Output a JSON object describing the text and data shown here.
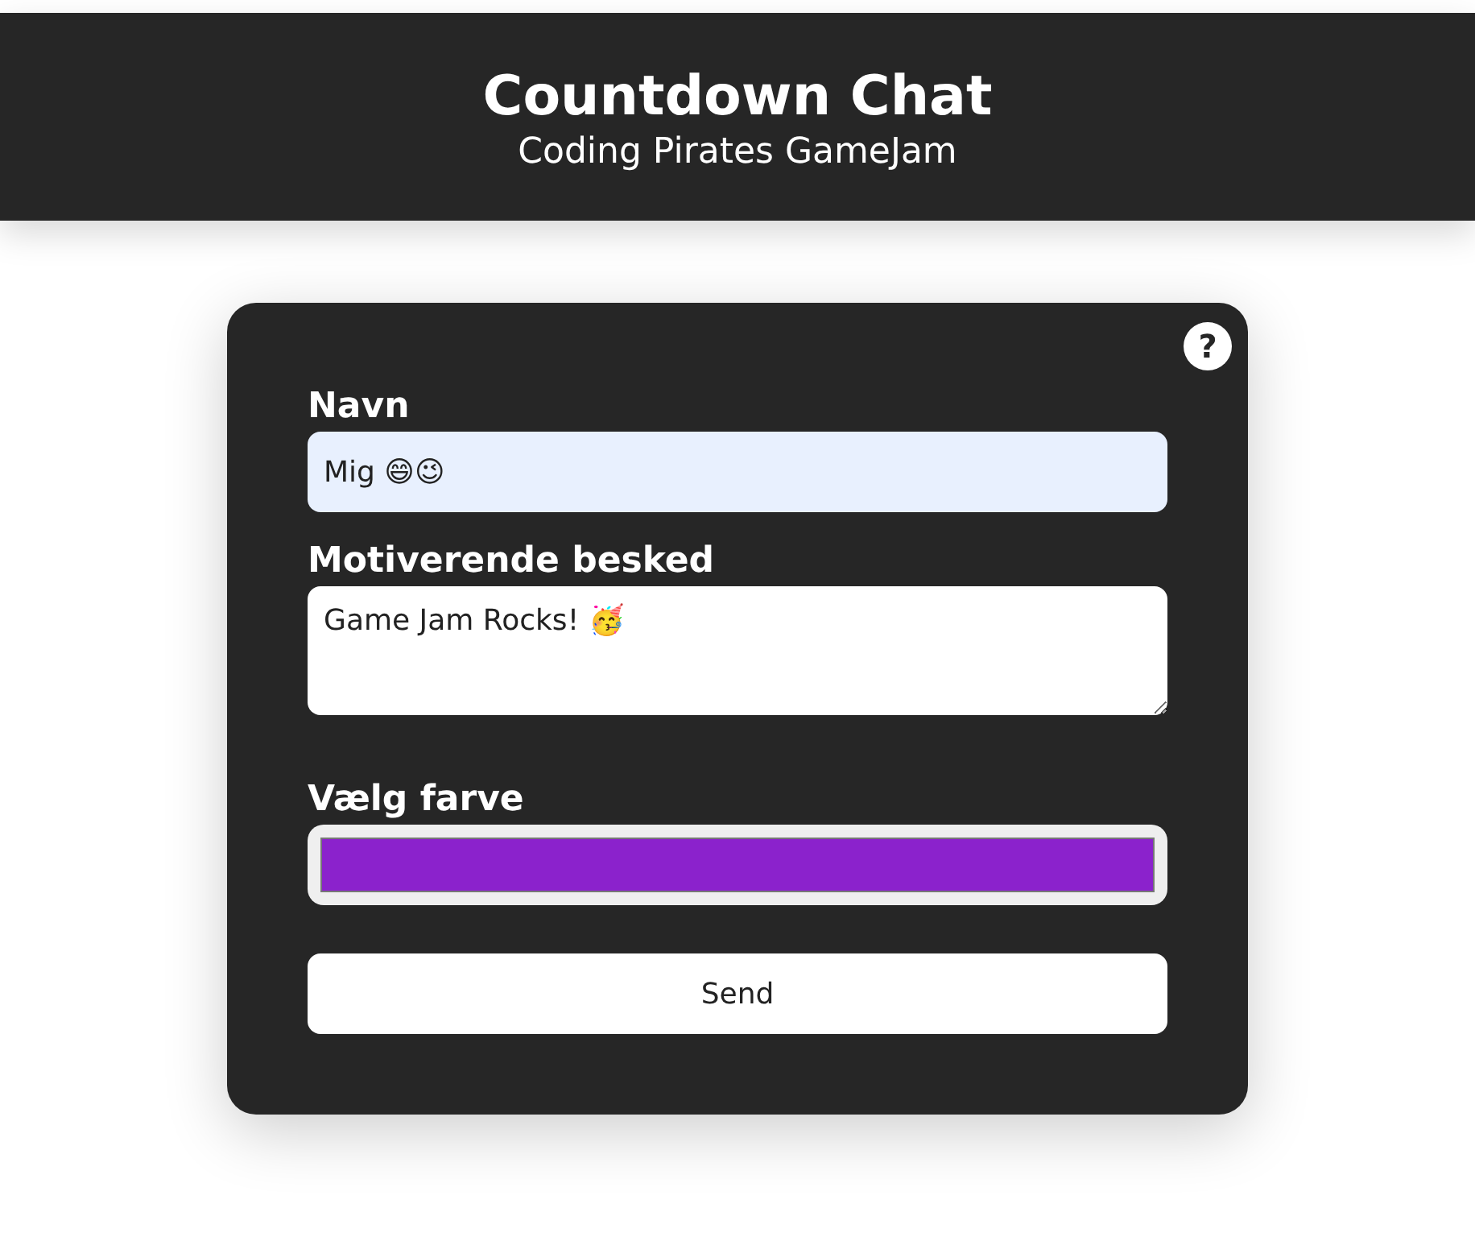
{
  "header": {
    "title": "Countdown Chat",
    "subtitle": "Coding Pirates GameJam"
  },
  "help_button": "?",
  "form": {
    "name_label": "Navn",
    "name_value": "Mig 😄😉",
    "message_label": "Motiverende besked",
    "message_value": "Game Jam Rocks! 🥳",
    "color_label": "Vælg farve",
    "color": "#8b22cc",
    "submit": "Send"
  }
}
